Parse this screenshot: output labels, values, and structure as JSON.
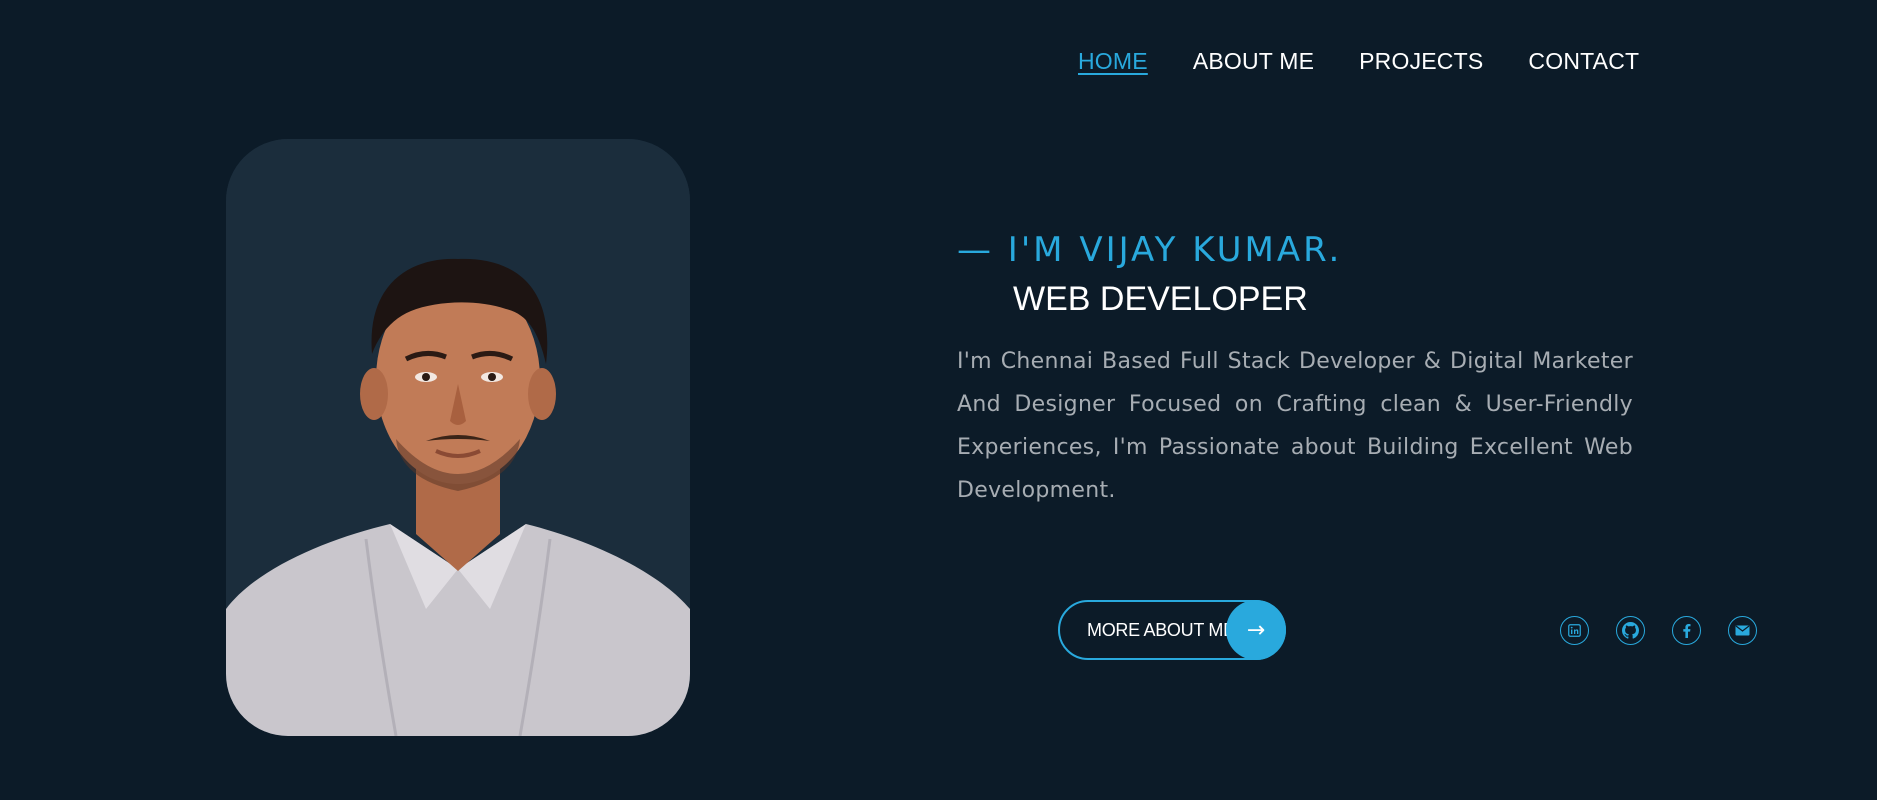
{
  "nav": {
    "items": [
      {
        "label": "HOME",
        "active": true
      },
      {
        "label": "ABOUT ME",
        "active": false
      },
      {
        "label": "PROJECTS",
        "active": false
      },
      {
        "label": "CONTACT",
        "active": false
      }
    ]
  },
  "hero": {
    "intro": "— I'M VIJAY KUMAR.",
    "role": "WEB DEVELOPER",
    "bio": "I'm Chennai Based Full Stack Developer & Digital Marketer And Designer Focused on Crafting clean & User-Friendly Experiences, I'm Passionate about Building Excellent Web Development.",
    "cta_label": "MORE ABOUT ME",
    "cta_arrow": "→"
  },
  "social": [
    {
      "icon": "linkedin-icon"
    },
    {
      "icon": "github-icon"
    },
    {
      "icon": "facebook-icon"
    },
    {
      "icon": "email-icon"
    }
  ],
  "colors": {
    "background": "#0c1b28",
    "accent": "#29a9dd",
    "card": "#1b2d3c",
    "text": "#ffffff",
    "muted": "#a7adb3"
  }
}
